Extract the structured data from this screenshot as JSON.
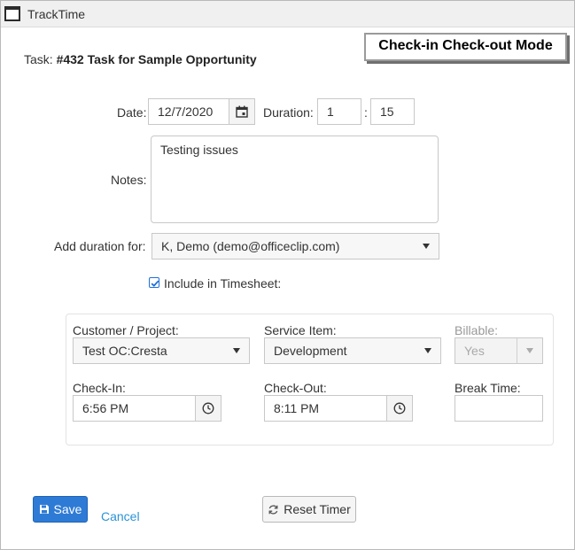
{
  "window": {
    "title": "TrackTime",
    "mode_badge": "Check-in Check-out Mode"
  },
  "task": {
    "label": "Task:",
    "name": "#432 Task for Sample Opportunity"
  },
  "form": {
    "date_label": "Date:",
    "date_value": "12/7/2020",
    "duration_label": "Duration:",
    "duration_hours": "1",
    "duration_separator": ":",
    "duration_minutes": "15",
    "notes_label": "Notes:",
    "notes_value": "Testing issues",
    "add_duration_label": "Add duration for:",
    "add_duration_value": "K, Demo (demo@officeclip.com)",
    "include_timesheet_label": "Include in Timesheet:",
    "include_timesheet_checked": true
  },
  "panel": {
    "customer_label": "Customer / Project:",
    "customer_value": "Test OC:Cresta",
    "service_label": "Service Item:",
    "service_value": "Development",
    "billable_label": "Billable:",
    "billable_value": "Yes",
    "checkin_label": "Check-In:",
    "checkin_value": "6:56 PM",
    "checkout_label": "Check-Out:",
    "checkout_value": "8:11 PM",
    "break_label": "Break Time:",
    "break_value": ""
  },
  "actions": {
    "save_label": "Save",
    "cancel_label": "Cancel",
    "reset_label": "Reset Timer"
  },
  "icons": {
    "app": "window-icon",
    "date": "calendar-icon",
    "time": "clock-icon",
    "save": "floppy-disk-icon",
    "reset": "refresh-icon"
  },
  "colors": {
    "primary": "#2e7bd6",
    "link": "#2a93d5",
    "checkbox": "#1e6fd9"
  }
}
